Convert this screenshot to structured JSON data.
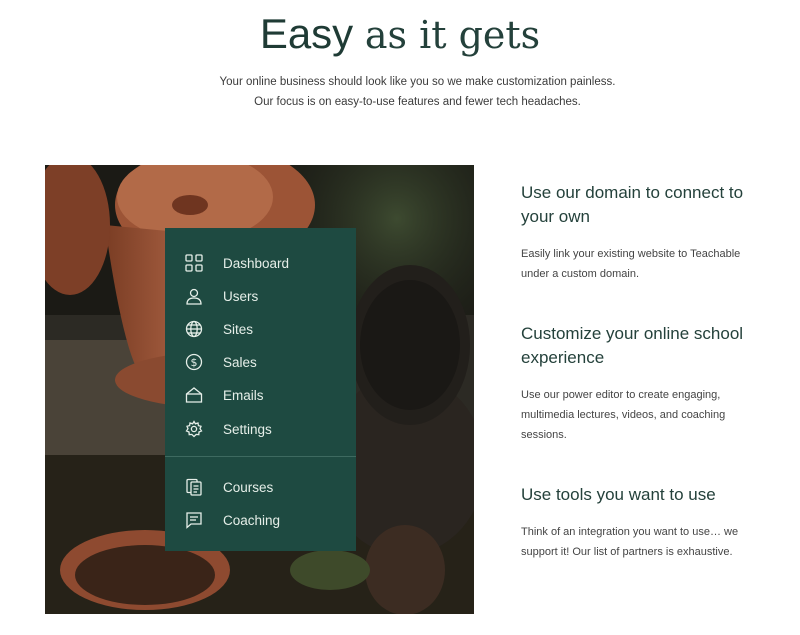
{
  "headline": {
    "part1": "Easy",
    "part2": "as it gets"
  },
  "subtext": {
    "line1": "Your online business should look like you so we make customization painless.",
    "line2": "Our focus is on easy-to-use features and fewer tech headaches."
  },
  "menu": {
    "items": [
      {
        "label": "Dashboard",
        "icon": "grid-icon"
      },
      {
        "label": "Users",
        "icon": "user-icon"
      },
      {
        "label": "Sites",
        "icon": "globe-icon"
      },
      {
        "label": "Sales",
        "icon": "dollar-icon"
      },
      {
        "label": "Emails",
        "icon": "envelope-icon"
      },
      {
        "label": "Settings",
        "icon": "gear-icon"
      }
    ],
    "secondary": [
      {
        "label": "Courses",
        "icon": "courses-icon"
      },
      {
        "label": "Coaching",
        "icon": "chat-icon"
      }
    ]
  },
  "features": [
    {
      "title": "Use our domain to connect to your own",
      "text": "Easily link your existing website to Teachable under a custom domain."
    },
    {
      "title": "Customize your online school experience",
      "text": "Use our power editor to create engaging, multimedia lectures, videos, and coaching sessions."
    },
    {
      "title": "Use tools you want to use",
      "text": "Think of an integration you want to use… we support it! Our list of partners is exhaustive."
    }
  ],
  "colors": {
    "menu_bg": "#1e4a41",
    "headline": "#1f3b35"
  }
}
